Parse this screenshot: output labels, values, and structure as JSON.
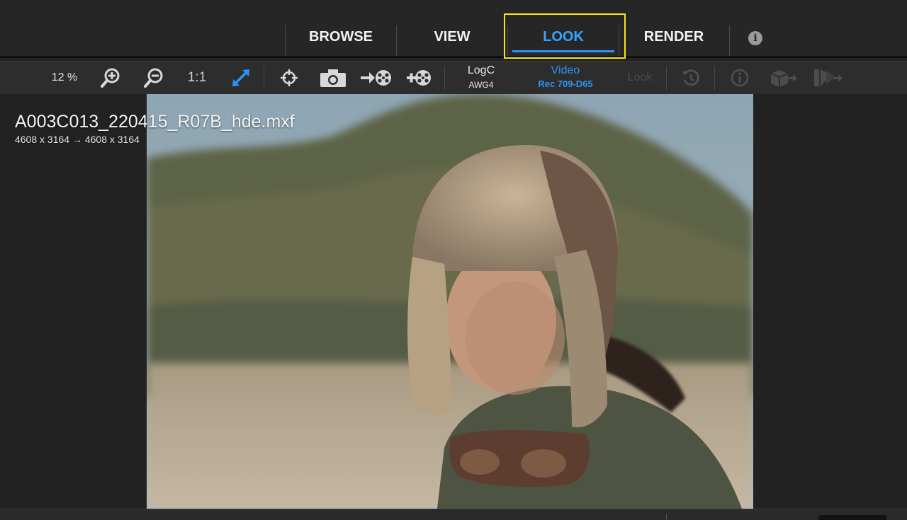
{
  "nav": {
    "tabs": [
      {
        "label": "BROWSE",
        "active": false
      },
      {
        "label": "VIEW",
        "active": false
      },
      {
        "label": "LOOK",
        "active": true
      },
      {
        "label": "RENDER",
        "active": false
      }
    ],
    "info_glyph": "i",
    "info_icon": "info-circle-icon"
  },
  "toolbar": {
    "zoom_value": "12 %",
    "one_to_one_label": "1:1",
    "icons": [
      "zoom-in-icon",
      "zoom-out-icon",
      "fit-to-window-icon",
      "crosshair-icon",
      "camera-icon",
      "export-frame-icon",
      "import-frame-icon",
      "history-icon",
      "info-circle-icon",
      "export-cube-icon",
      "export-look-icon"
    ],
    "input_colorspace": {
      "main": "LogC",
      "sub": "AWG4"
    },
    "output_colorspace": {
      "main": "Video",
      "sub": "Rec 709-D65"
    },
    "look_label": "Look",
    "accent_color": "#2b95f2"
  },
  "clip": {
    "title": "A003C013_220415_R07B_hde.mxf",
    "resolution": "4608 x 3164  → 4608 x 3164"
  }
}
